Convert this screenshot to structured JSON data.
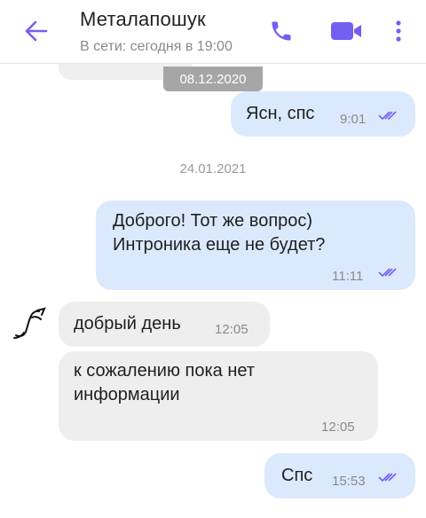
{
  "header": {
    "title": "Металапошук",
    "status": "В сети: сегодня в 19:00",
    "colors": {
      "accent": "#7360f2",
      "text": "#222222",
      "secondary": "#8a8a8a"
    }
  },
  "icons": {
    "back": "arrow-left-icon",
    "call": "phone-icon",
    "video": "video-camera-icon",
    "more": "more-vertical-icon",
    "read": "double-check-icon",
    "avatar": "scribble-avatar-icon"
  },
  "chat": {
    "pinned_date": "08.12.2020",
    "separator_date": "24.01.2021",
    "messages": [
      {
        "direction": "out",
        "text": "Ясн, спс",
        "time": "9:01",
        "read": true
      },
      {
        "direction": "out",
        "text": "Доброго! Тот же вопрос)\nИнтроника еще не будет?",
        "time": "11:11",
        "read": true
      },
      {
        "direction": "in",
        "text": "добрый день",
        "time": "12:05"
      },
      {
        "direction": "in",
        "text": "к сожалению пока нет\nинформации",
        "time": "12:05"
      },
      {
        "direction": "out",
        "text": "Спс",
        "time": "15:53",
        "read": true
      }
    ]
  },
  "colors": {
    "outgoing_bubble": "#dbe9fd",
    "incoming_bubble": "#eeeeee",
    "date_chip": "#a6a6a6",
    "read_ticks": "#7360f2"
  }
}
